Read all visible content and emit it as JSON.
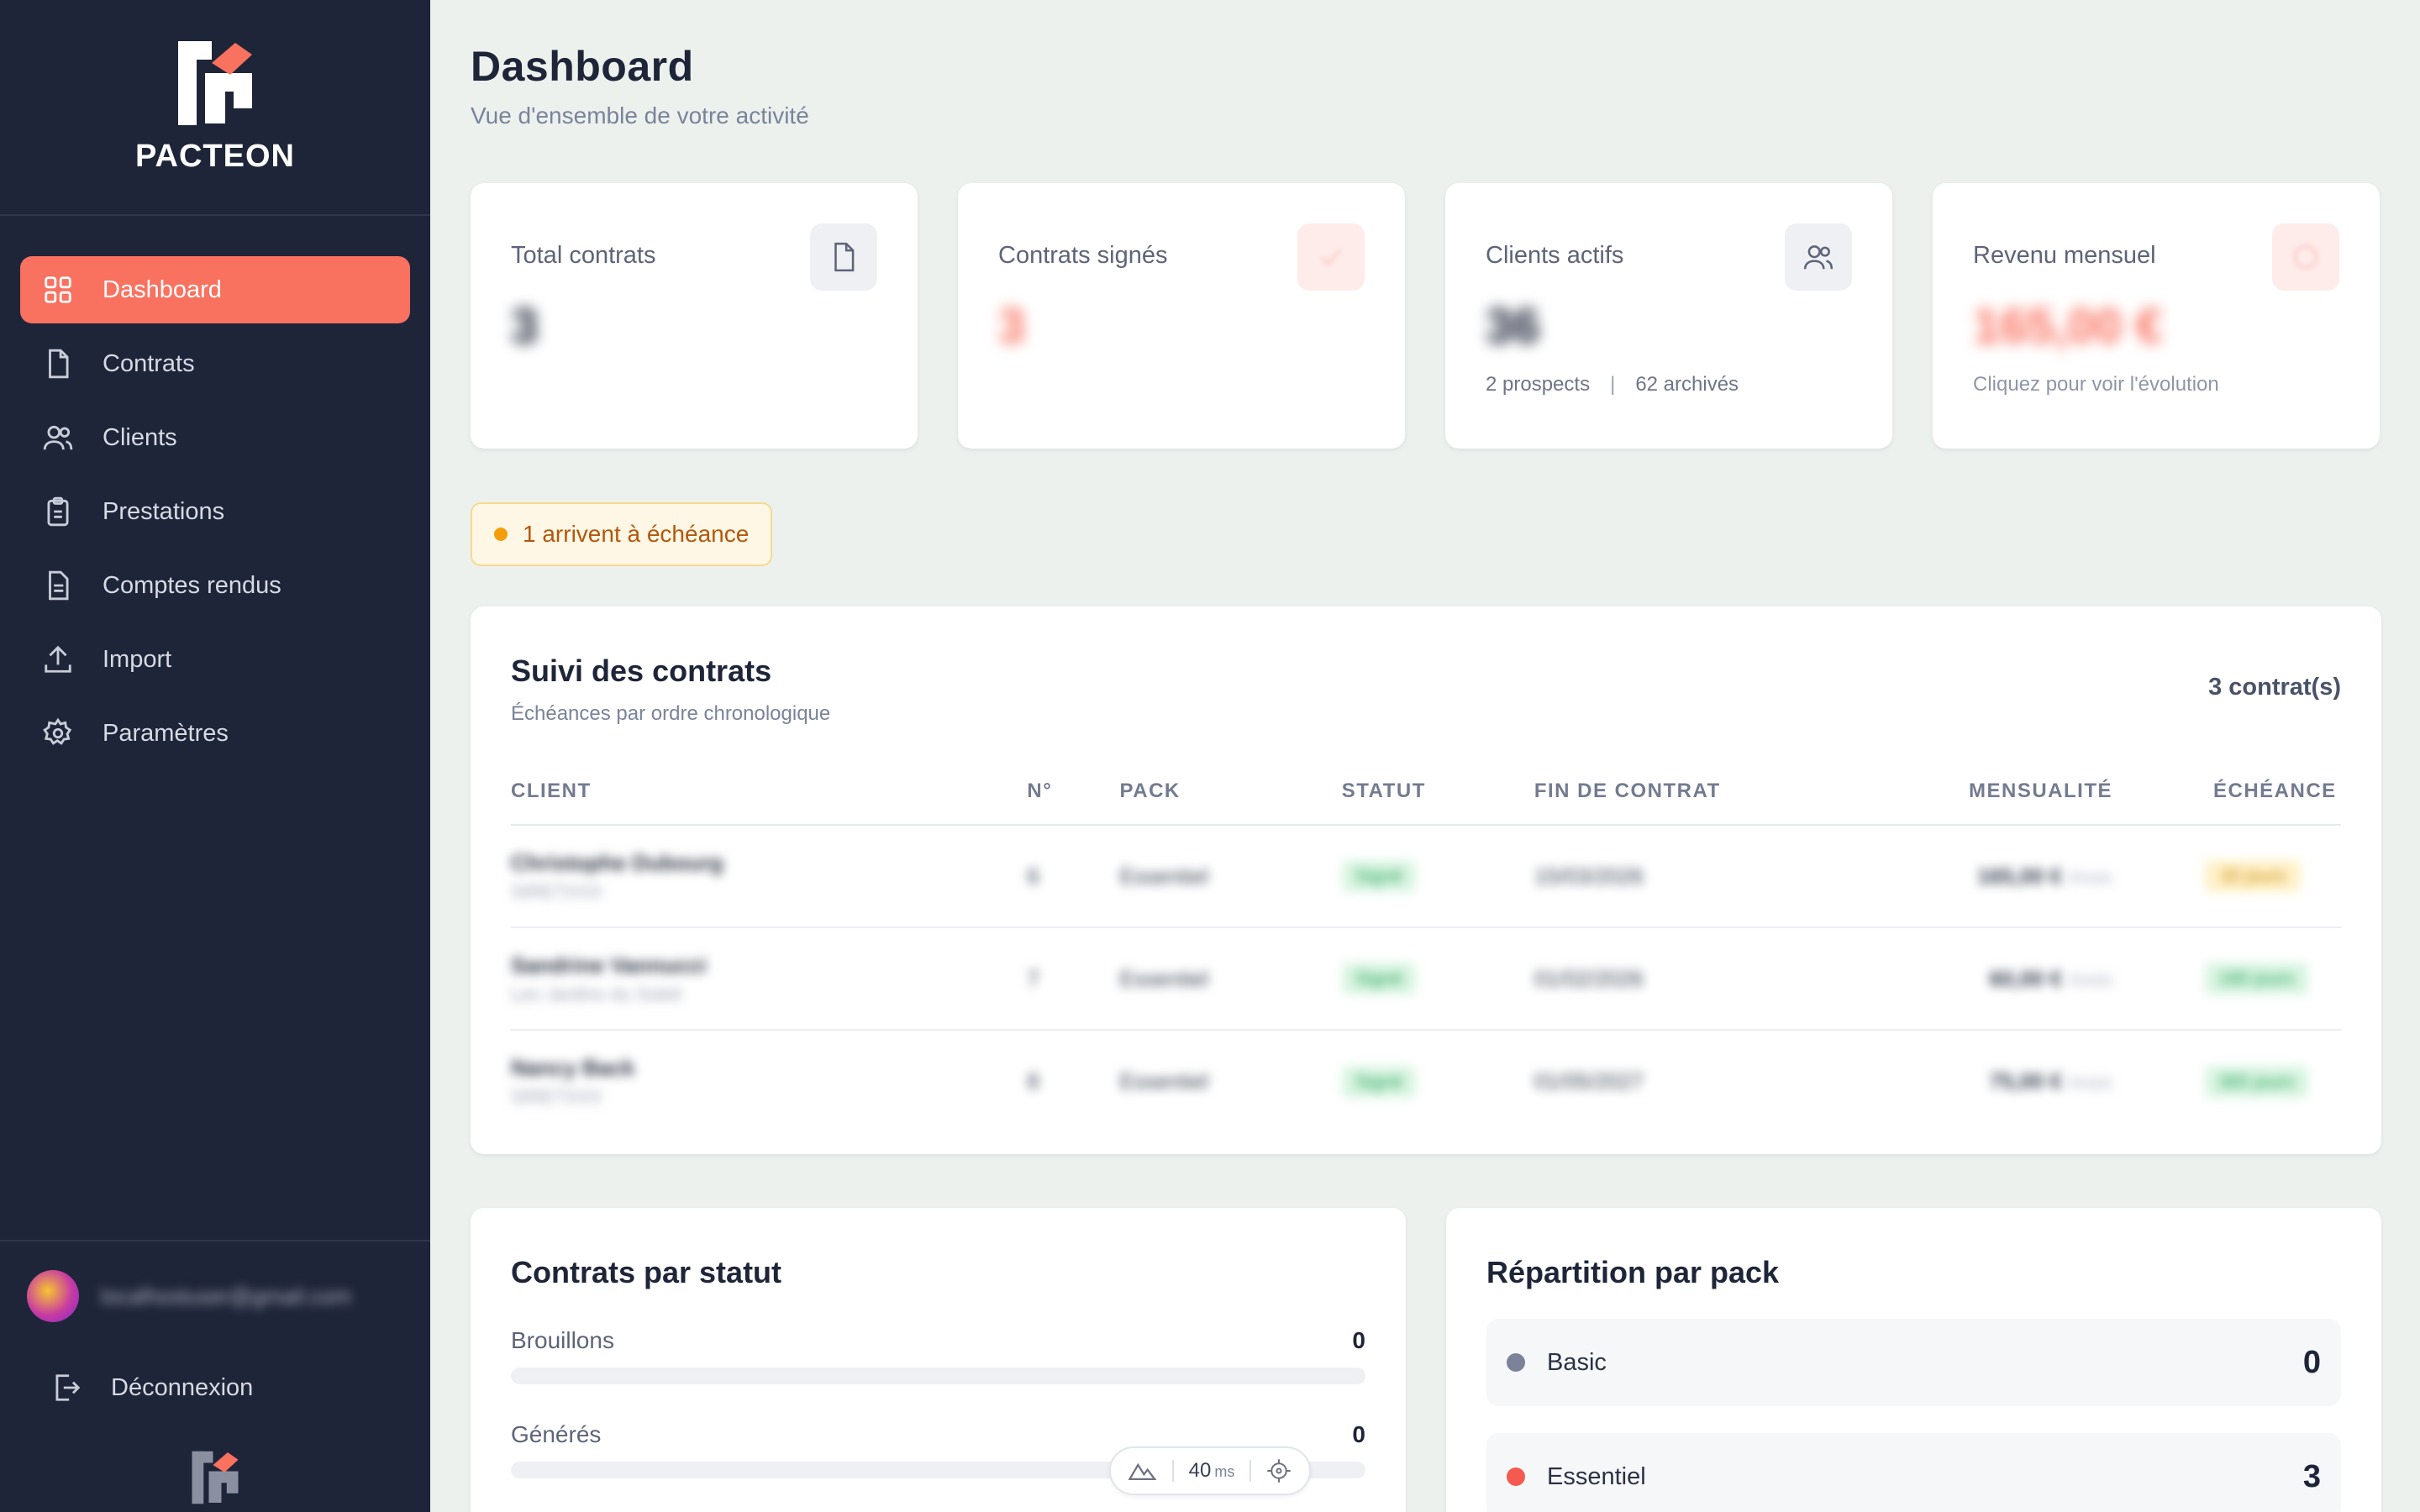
{
  "brand": {
    "name": "PACTEON"
  },
  "sidebar": {
    "items": [
      {
        "label": "Dashboard",
        "icon": "grid-icon",
        "active": true
      },
      {
        "label": "Contrats",
        "icon": "file-icon"
      },
      {
        "label": "Clients",
        "icon": "users-icon"
      },
      {
        "label": "Prestations",
        "icon": "clipboard-icon"
      },
      {
        "label": "Comptes rendus",
        "icon": "document-text-icon"
      },
      {
        "label": "Import",
        "icon": "upload-icon"
      },
      {
        "label": "Paramètres",
        "icon": "gear-icon"
      }
    ],
    "user_email": "localhostuser@gmail.com",
    "logout_label": "Déconnexion"
  },
  "header": {
    "title": "Dashboard",
    "subtitle": "Vue d'ensemble de votre activité"
  },
  "stats": [
    {
      "label": "Total contrats",
      "value": "3",
      "icon": "file-icon"
    },
    {
      "label": "Contrats signés",
      "value": "3",
      "icon": "check-icon"
    },
    {
      "label": "Clients actifs",
      "value": "36",
      "icon": "users-icon",
      "meta_prospects": "2 prospects",
      "meta_sep": "|",
      "meta_archived": "62 archivés"
    },
    {
      "label": "Revenu mensuel",
      "value": "165,00 €",
      "icon": "euro-icon",
      "hint": "Cliquez pour voir l'évolution"
    }
  ],
  "alert": {
    "label": "1 arrivent à échéance"
  },
  "contracts": {
    "title": "Suivi des contrats",
    "subtitle": "Échéances par ordre chronologique",
    "count": "3 contrat(s)",
    "columns": [
      "CLIENT",
      "N°",
      "PACK",
      "STATUT",
      "FIN DE CONTRAT",
      "MENSUALITÉ",
      "ÉCHÉANCE"
    ],
    "rows": [
      {
        "client": "Christophe Dubourg",
        "client_sub": "SIRETXXX",
        "num": "6",
        "pack": "Essentiel",
        "status": "Signé",
        "end": "15/03/2026",
        "amount": "165,00 €",
        "unit": "/mois",
        "due": "30 jours"
      },
      {
        "client": "Sandrine Vannucci",
        "client_sub": "Les Jardins du Soleil",
        "num": "7",
        "pack": "Essentiel",
        "status": "Signé",
        "end": "01/02/2026",
        "amount": "60,00 €",
        "unit": "/mois",
        "due": "180 jours"
      },
      {
        "client": "Nancy Back",
        "client_sub": "SIRETXXX",
        "num": "8",
        "pack": "Essentiel",
        "status": "Signé",
        "end": "01/05/2027",
        "amount": "75,00 €",
        "unit": "/mois",
        "due": "365 jours"
      }
    ]
  },
  "status_panel": {
    "title": "Contrats par statut",
    "rows": [
      {
        "label": "Brouillons",
        "value": "0",
        "fraction": 0
      },
      {
        "label": "Générés",
        "value": "0",
        "fraction": 0
      }
    ]
  },
  "pack_panel": {
    "title": "Répartition par pack",
    "items": [
      {
        "label": "Basic",
        "count": "0",
        "color": "#7b8299"
      },
      {
        "label": "Essentiel",
        "count": "3",
        "color": "#f55a4e"
      }
    ]
  },
  "perf_widget": {
    "value": "40",
    "unit": "ms"
  },
  "colors": {
    "accent": "#f9715f",
    "sidebar": "#1f2538",
    "background": "#edf1ee"
  }
}
